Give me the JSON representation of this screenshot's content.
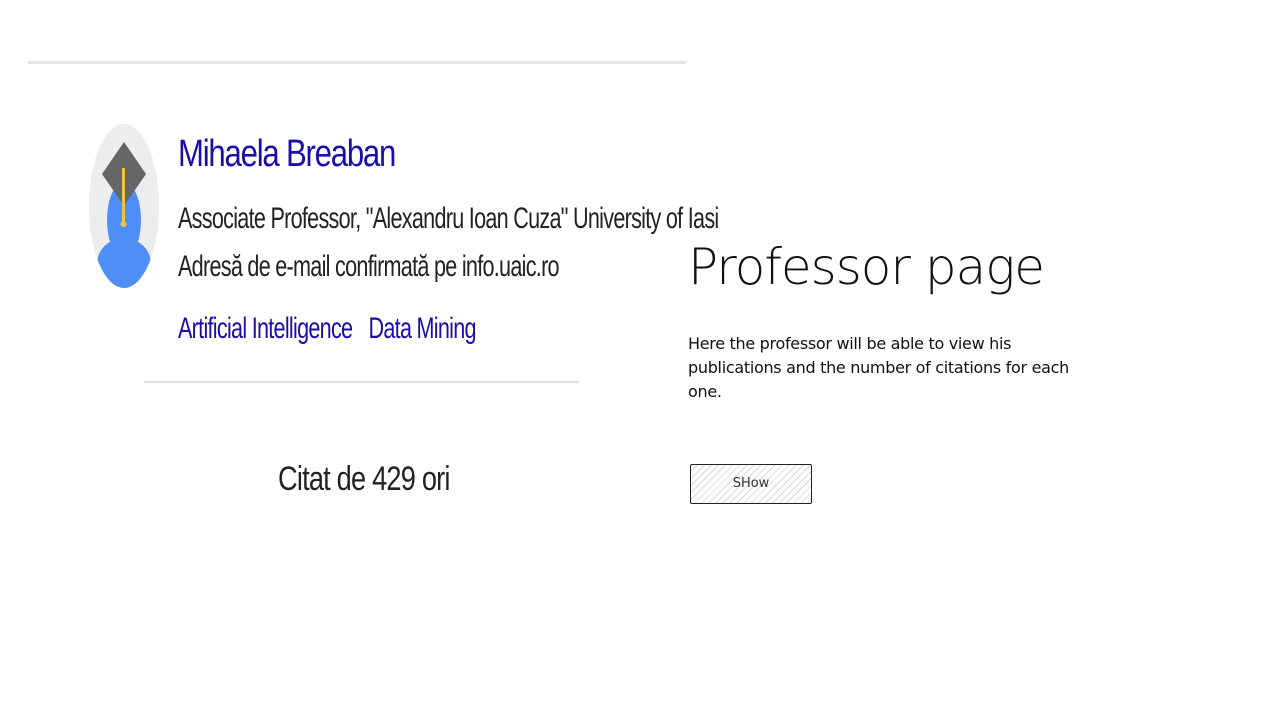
{
  "profile": {
    "name": "Mihaela Breaban",
    "affiliation": "Associate Professor, \"Alexandru Ioan Cuza\" University of Iasi",
    "email_verified": "Adresă de e-mail confirmată pe info.uaic.ro",
    "interests": [
      "Artificial Intelligence",
      "Data Mining"
    ],
    "citations": "Citat de 429 ori",
    "avatar_icon": "graduate-avatar-icon"
  },
  "annotation": {
    "heading": "Professor page",
    "description": "Here the professor will be able to view his publications and the number of citations for each one.",
    "show_button_label": "SHow"
  },
  "colors": {
    "link": "#1a0dab",
    "text": "#222222",
    "avatar_blue": "#4f8ef7",
    "avatar_cap": "#666666",
    "tassel": "#f0c43a"
  }
}
